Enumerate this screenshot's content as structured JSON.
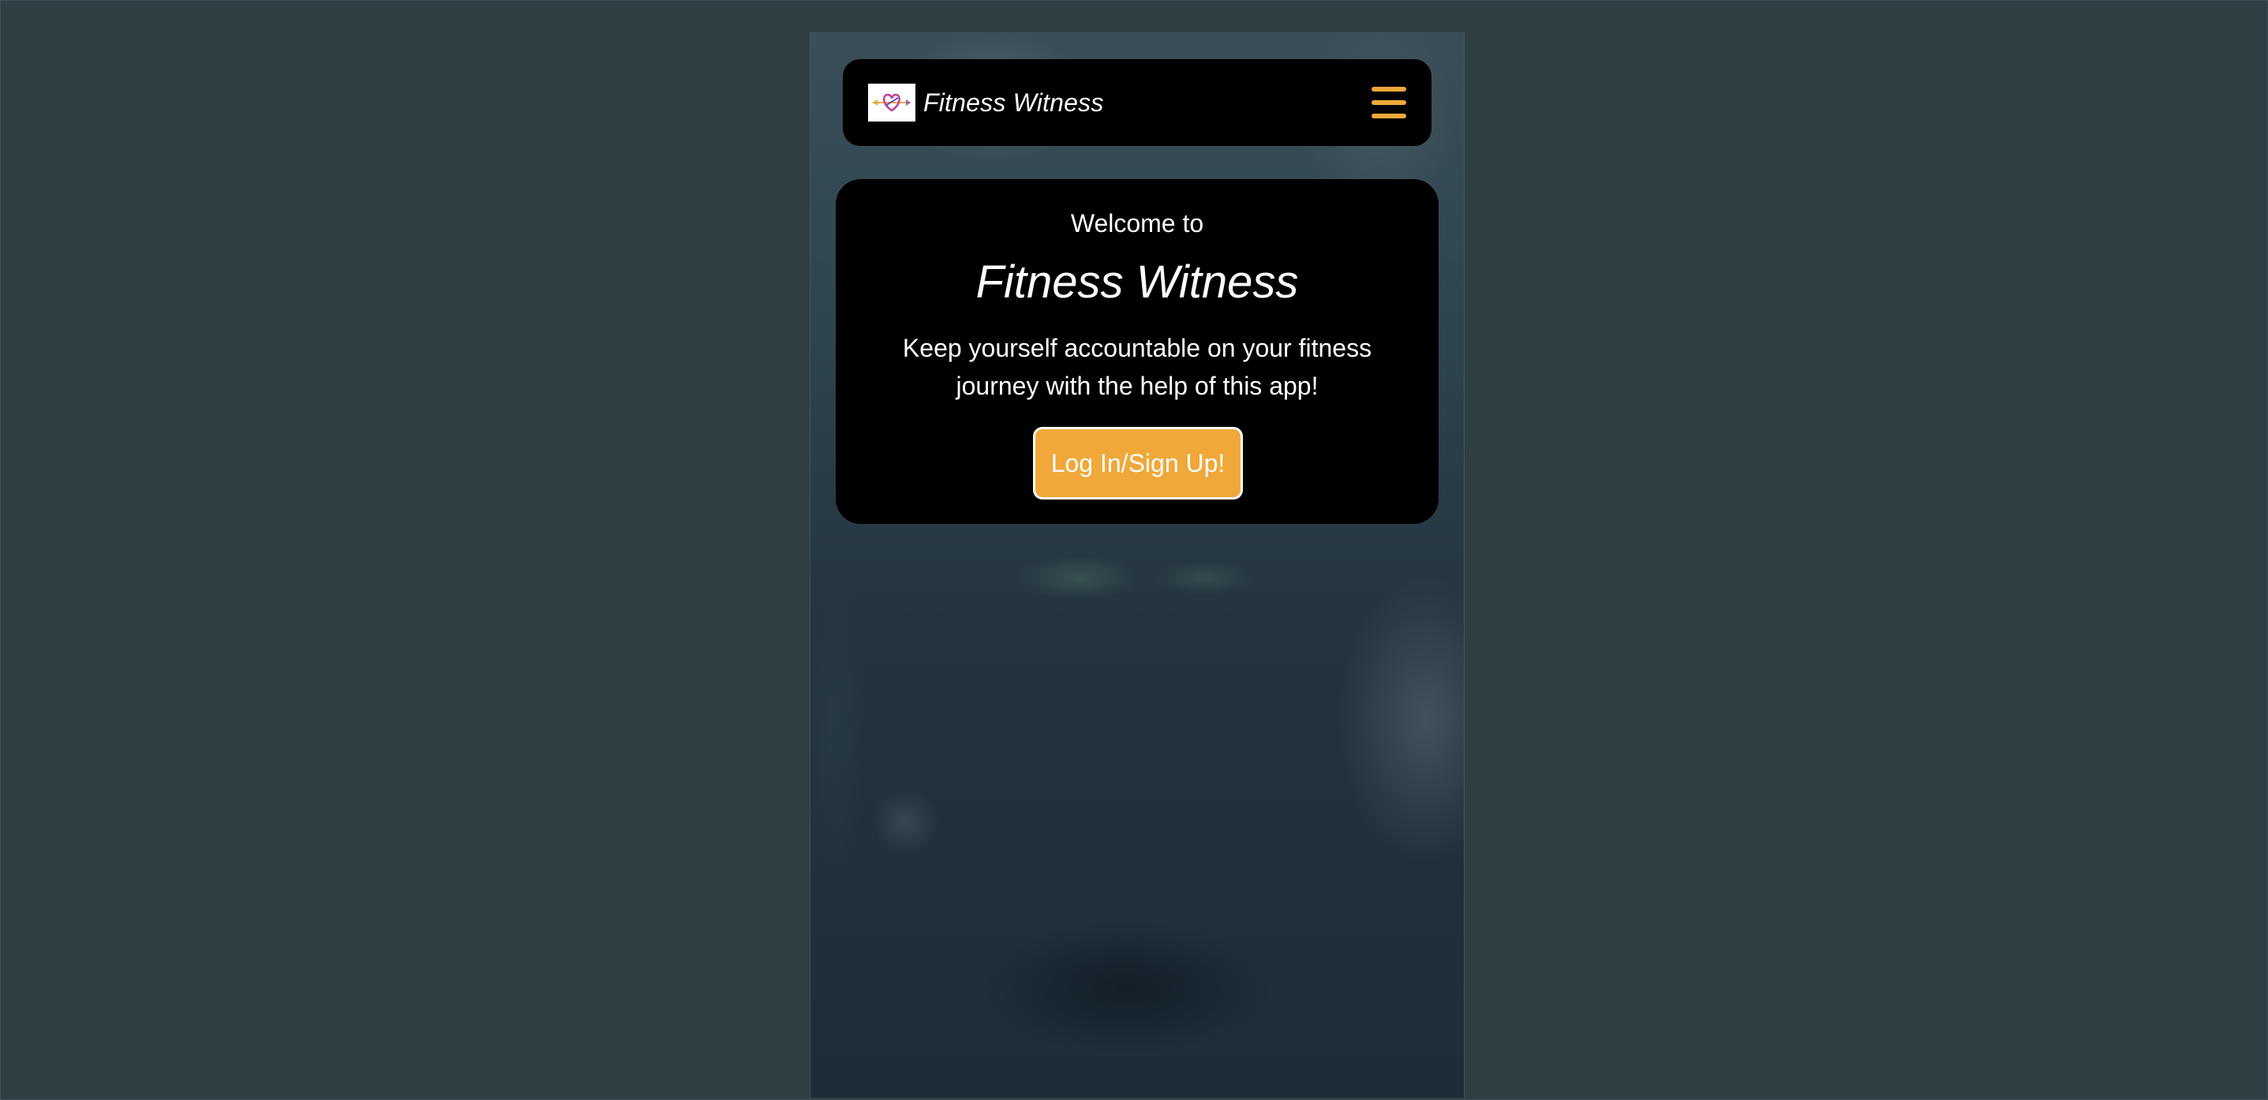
{
  "navbar": {
    "brand_name": "Fitness Witness",
    "logo_icon": "heart-arrow-logo-icon",
    "menu_icon": "hamburger-menu-icon"
  },
  "hero": {
    "welcome": "Welcome to",
    "title": "Fitness Witness",
    "tagline": "Keep yourself accountable on your fitness journey with the help of this app!",
    "cta_label": "Log In/Sign Up!"
  },
  "colors": {
    "accent": "#f0a83a",
    "card_background": "#000000",
    "page_background": "#2e3e42"
  }
}
